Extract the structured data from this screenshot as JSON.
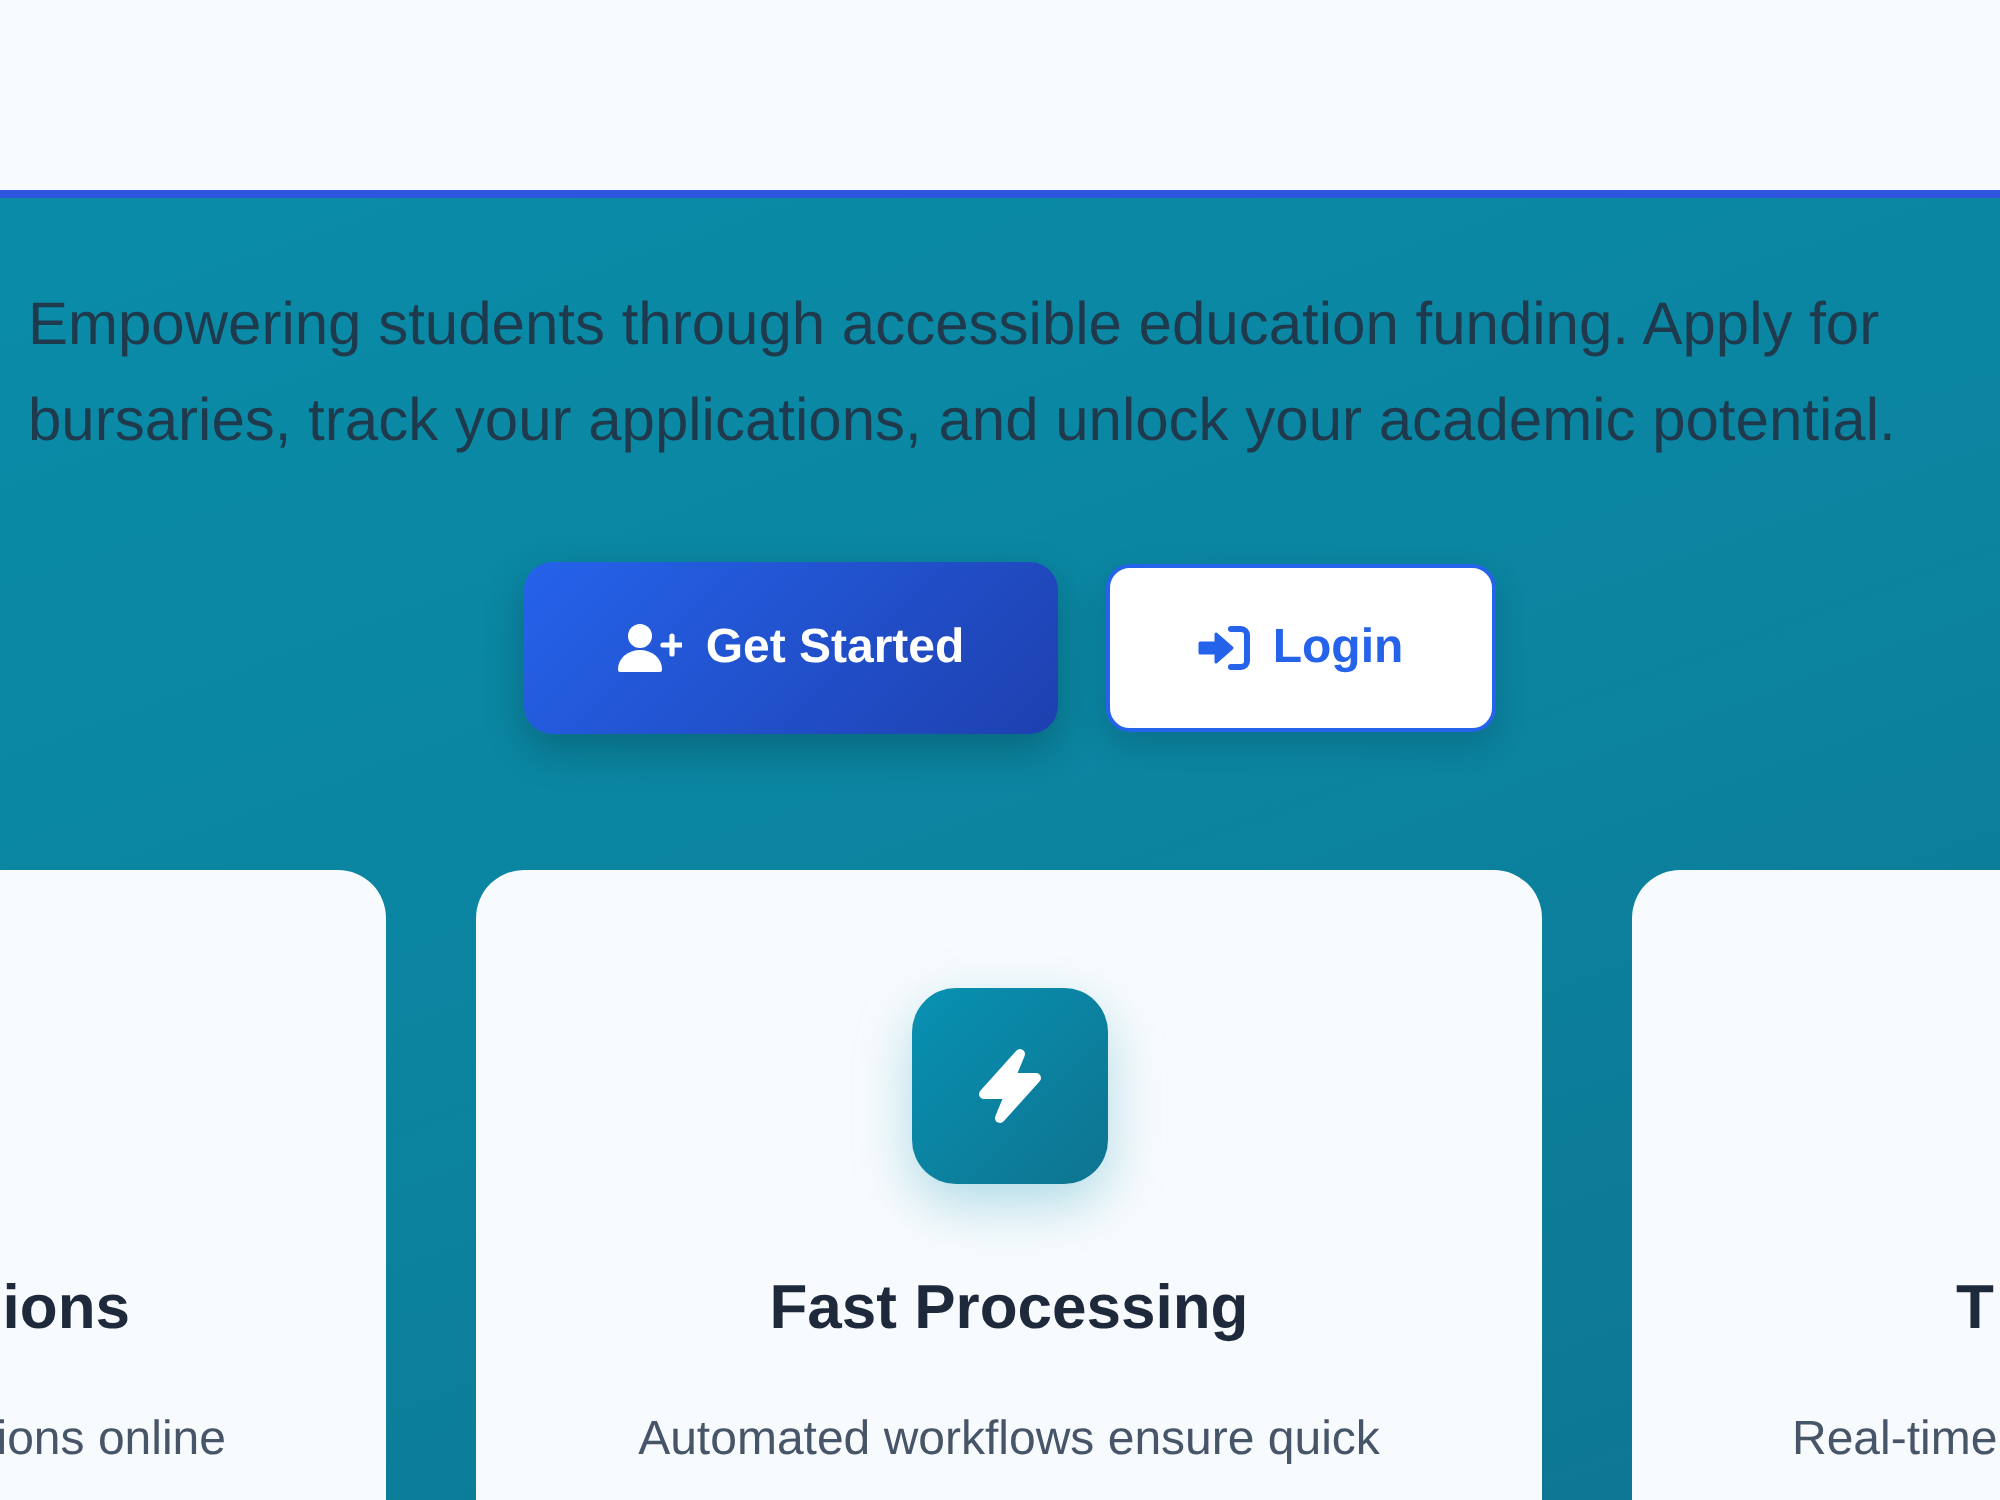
{
  "hero": {
    "tagline": "Empowering students through accessible education funding. Apply for bursaries, track your applications, and unlock your academic potential.",
    "buttons": [
      {
        "label": "Get Started",
        "kind": "primary"
      },
      {
        "label": "Login",
        "kind": "secondary"
      }
    ]
  },
  "features": [
    {
      "title": "ions",
      "description": "ions online"
    },
    {
      "title": "Fast Processing",
      "description": "Automated workflows ensure quick"
    },
    {
      "title": "T",
      "description": "Real-time"
    }
  ]
}
